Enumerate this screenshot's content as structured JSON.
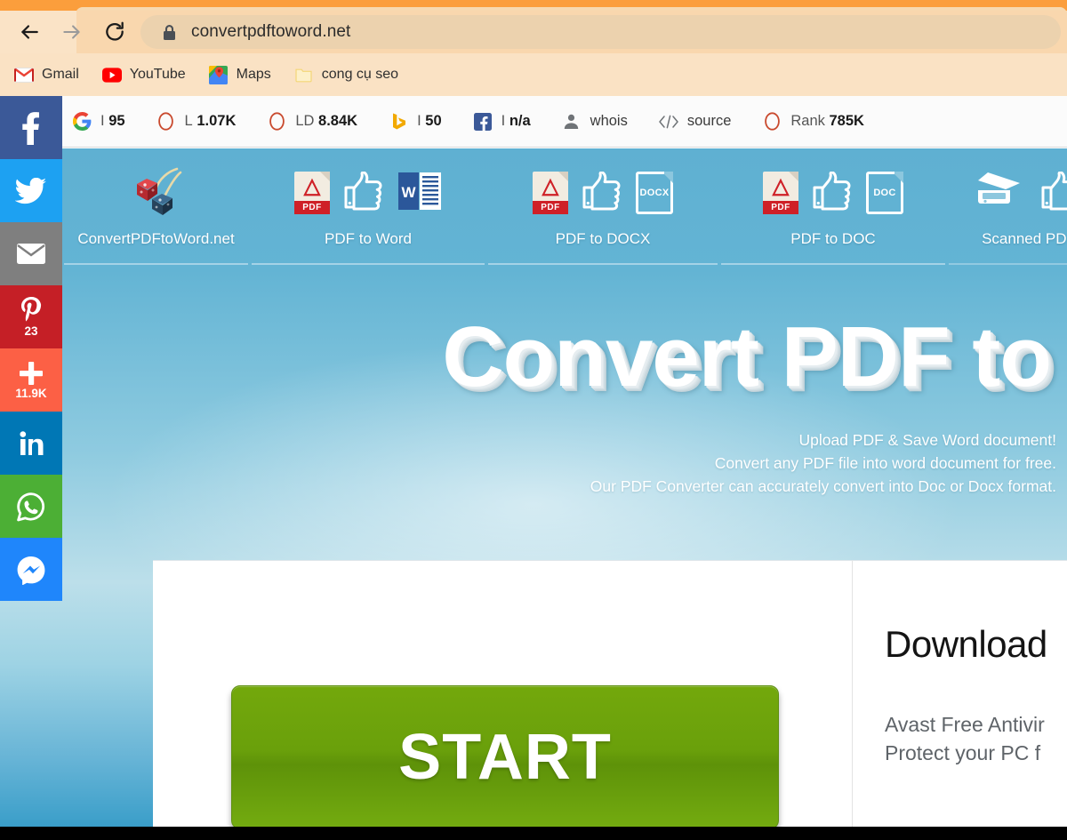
{
  "browser": {
    "url": "convertpdftoword.net",
    "back_label": "Back",
    "forward_label": "Forward",
    "reload_label": "Reload",
    "lock_icon": "lock-icon",
    "bookmarks": [
      {
        "label": "Gmail",
        "icon": "gmail-icon"
      },
      {
        "label": "YouTube",
        "icon": "youtube-icon"
      },
      {
        "label": "Maps",
        "icon": "google-maps-icon"
      },
      {
        "label": "cong cụ seo",
        "icon": "folder-icon"
      }
    ]
  },
  "seoquake": {
    "logo": "seoquake-logo",
    "items": [
      {
        "icon": "google-icon",
        "prefix": "I",
        "value": "95",
        "label": ""
      },
      {
        "icon": "moz-circle-icon",
        "prefix": "L",
        "value": "1.07K",
        "label": ""
      },
      {
        "icon": "moz-circle-icon",
        "prefix": "LD",
        "value": "8.84K",
        "label": ""
      },
      {
        "icon": "bing-icon",
        "prefix": "I",
        "value": "50",
        "label": ""
      },
      {
        "icon": "facebook-icon",
        "prefix": "I",
        "value": "n/a",
        "label": ""
      },
      {
        "icon": "person-icon",
        "prefix": "",
        "value": "",
        "label": "whois"
      },
      {
        "icon": "source-code-icon",
        "prefix": "",
        "value": "",
        "label": "source"
      },
      {
        "icon": "alexa-circle-icon",
        "prefix": "Rank",
        "value": "785K",
        "label": ""
      }
    ]
  },
  "site": {
    "nav": [
      {
        "label": "ConvertPDFtoWord.net",
        "icons": [
          "cherry-dice-logo"
        ]
      },
      {
        "label": "PDF to Word",
        "icons": [
          "pdf-file-icon",
          "thumbs-up-icon",
          "word-icon"
        ]
      },
      {
        "label": "PDF to DOCX",
        "icons": [
          "pdf-file-icon",
          "thumbs-up-icon",
          "docx-file-icon"
        ]
      },
      {
        "label": "PDF to DOC",
        "icons": [
          "pdf-file-icon",
          "thumbs-up-icon",
          "doc-file-icon"
        ]
      },
      {
        "label": "Scanned PDF",
        "icons": [
          "scanner-icon",
          "thumbs-up-icon"
        ]
      }
    ],
    "hero": {
      "title": "Convert PDF to",
      "sub_line1": "Upload PDF & Save Word document!",
      "sub_line2": "Convert any PDF file into word document for free.",
      "sub_line3": "Our PDF Converter can accurately convert into Doc or Docx format."
    },
    "start_button": "START",
    "ad": {
      "title": "Download",
      "line1": "Avast Free Antivir",
      "line2": "Protect your PC f"
    }
  },
  "social": [
    {
      "name": "facebook",
      "glyph": "f",
      "count": "",
      "color": "#3b5998"
    },
    {
      "name": "twitter",
      "glyph": "t",
      "count": "",
      "color": "#1da1f2"
    },
    {
      "name": "email",
      "glyph": "✉",
      "count": "",
      "color": "#7f7f7f"
    },
    {
      "name": "pinterest",
      "glyph": "P",
      "count": "23",
      "color": "#c51f26"
    },
    {
      "name": "addthis",
      "glyph": "+",
      "count": "11.9K",
      "color": "#fc6045"
    },
    {
      "name": "linkedin",
      "glyph": "in",
      "count": "",
      "color": "#0077b5"
    },
    {
      "name": "whatsapp",
      "glyph": "w",
      "count": "",
      "color": "#4caf35"
    },
    {
      "name": "messenger",
      "glyph": "m",
      "count": "",
      "color": "#1f86fb"
    }
  ],
  "colors": {
    "chrome_orange": "#fb9e3c",
    "toolbar": "#f9d7ae",
    "page_blue": "#63b4d4",
    "start_green": "#6aa00b",
    "bottom_bar": "#000000"
  }
}
